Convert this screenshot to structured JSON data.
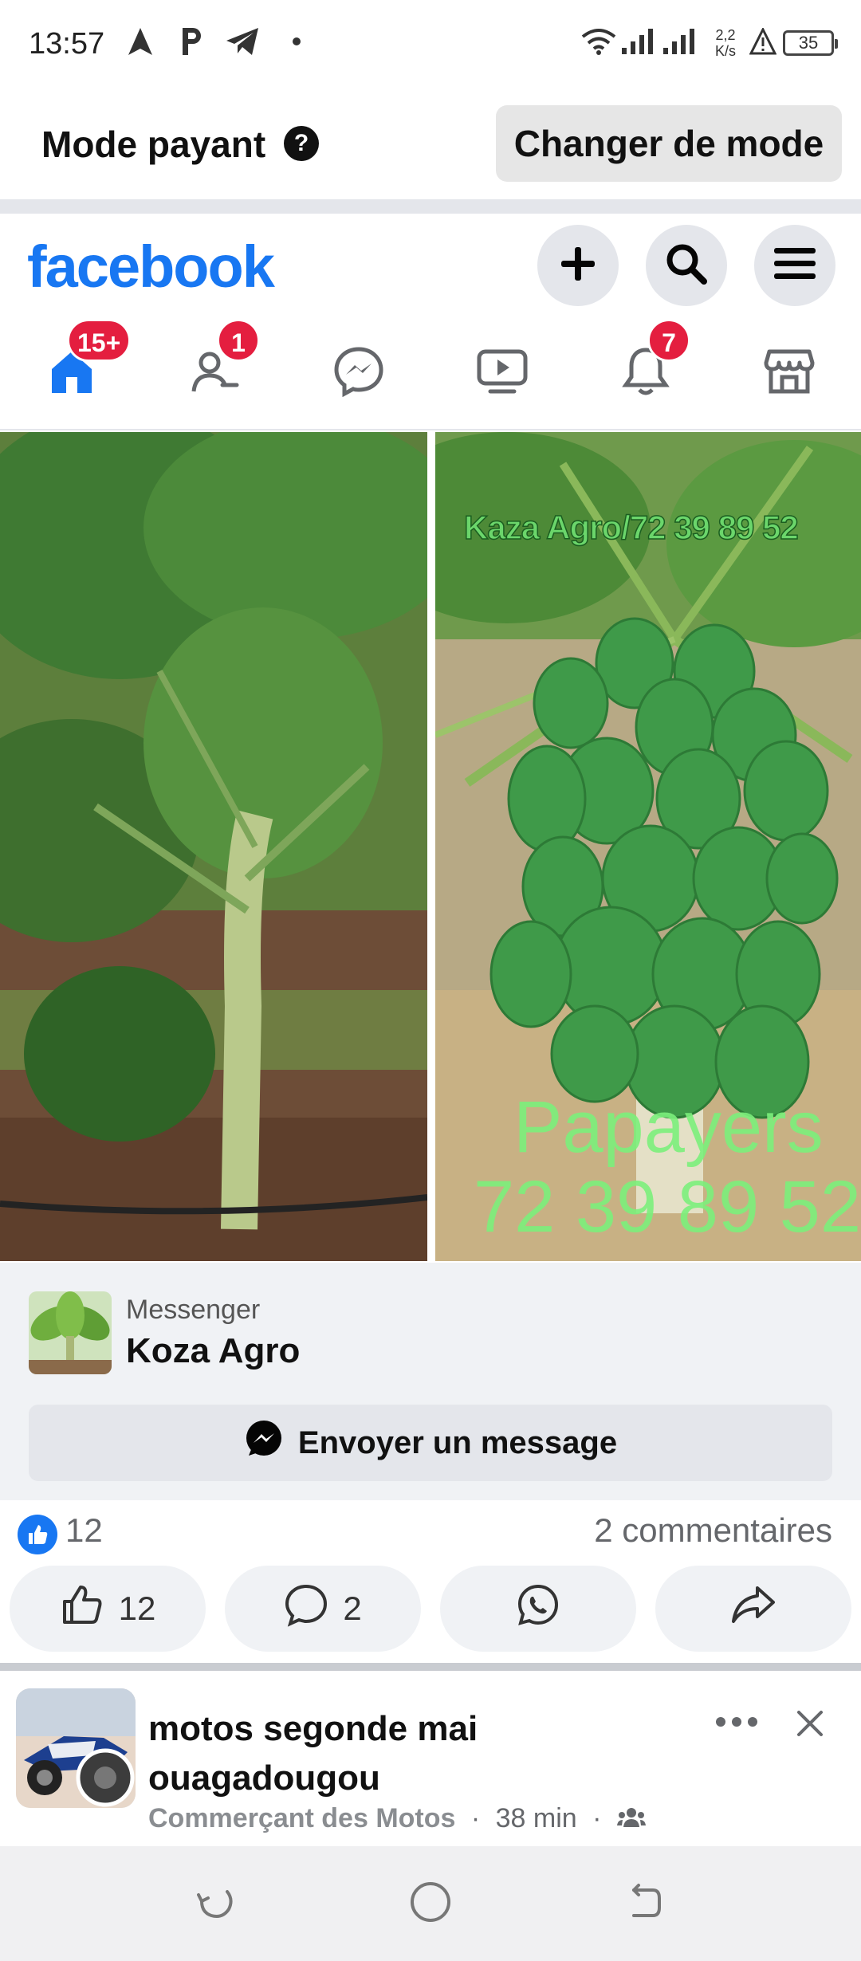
{
  "status_bar": {
    "time": "13:57",
    "speed_value": "2,2",
    "speed_unit": "K/s",
    "battery": "35",
    "icons": [
      "navigation-icon",
      "parking-icon",
      "telegram-icon",
      "dot-icon",
      "wifi-icon",
      "signal-icon",
      "signal-icon",
      "alert-icon",
      "battery-icon"
    ]
  },
  "mode_bar": {
    "label": "Mode payant",
    "change_button": "Changer de mode"
  },
  "fb_header": {
    "logo": "facebook",
    "brand_color": "#1877f2",
    "action_buttons": [
      "plus-icon",
      "search-icon",
      "menu-icon"
    ],
    "tabs": [
      {
        "icon": "home-icon",
        "badge": "15+"
      },
      {
        "icon": "friends-icon",
        "badge": "1"
      },
      {
        "icon": "messenger-icon",
        "badge": ""
      },
      {
        "icon": "video-icon",
        "badge": ""
      },
      {
        "icon": "bell-icon",
        "badge": "7"
      },
      {
        "icon": "marketplace-icon",
        "badge": ""
      }
    ]
  },
  "post": {
    "image_overlay_top": "Kaza Agro/72 39 89 52",
    "image_overlay_title": "Papayers",
    "image_overlay_phone": "72 39 89 52",
    "cta": {
      "subtitle": "Messenger",
      "page_name": "Koza Agro",
      "button": "Envoyer un message"
    },
    "likes": "12",
    "comments": "2 commentaires",
    "actions": {
      "like_count": "12",
      "comment_count": "2"
    }
  },
  "next_post": {
    "title": "motos  segonde mai ouagadougou",
    "author": "Commerçant des Motos",
    "separator": "·",
    "time": "38 min"
  }
}
